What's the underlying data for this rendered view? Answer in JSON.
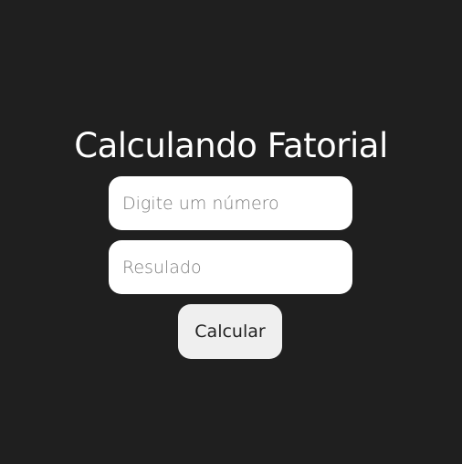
{
  "form": {
    "title": "Calculando Fatorial",
    "number_input": {
      "placeholder": "Digite um número",
      "value": ""
    },
    "result_input": {
      "placeholder": "Resulado",
      "value": ""
    },
    "calculate_label": "Calcular"
  },
  "colors": {
    "background": "#1f1f1f",
    "title_text": "#ffffff",
    "input_background": "#ffffff",
    "placeholder_text": "#7b7b7b",
    "button_background": "#efefef",
    "button_text": "#1f1f1f"
  }
}
